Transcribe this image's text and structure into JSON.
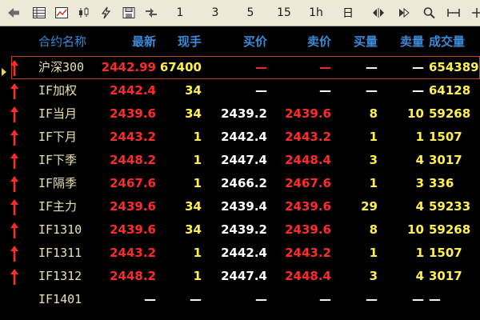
{
  "toolbar": {
    "periods": [
      "1",
      "3",
      "5",
      "15",
      "1h",
      "日"
    ]
  },
  "columns": {
    "name": "合约名称",
    "last": "最新",
    "volume_now": "现手",
    "bid": "买价",
    "ask": "卖价",
    "bid_qty": "买量",
    "ask_qty": "卖量",
    "turnover": "成交量"
  },
  "rows": [
    {
      "name": "沪深300",
      "last": "2442.99",
      "volume_now": "67400",
      "bid": "—",
      "ask": "—",
      "bid_qty": "—",
      "ask_qty": "—",
      "turnover": "654389"
    },
    {
      "name": "IF加权",
      "last": "2442.4",
      "volume_now": "34",
      "bid": "—",
      "ask": "—",
      "bid_qty": "—",
      "ask_qty": "—",
      "turnover": "64128"
    },
    {
      "name": "IF当月",
      "last": "2439.6",
      "volume_now": "34",
      "bid": "2439.2",
      "ask": "2439.6",
      "bid_qty": "8",
      "ask_qty": "10",
      "turnover": "59268"
    },
    {
      "name": "IF下月",
      "last": "2443.2",
      "volume_now": "1",
      "bid": "2442.4",
      "ask": "2443.2",
      "bid_qty": "1",
      "ask_qty": "1",
      "turnover": "1507"
    },
    {
      "name": "IF下季",
      "last": "2448.2",
      "volume_now": "1",
      "bid": "2447.4",
      "ask": "2448.4",
      "bid_qty": "3",
      "ask_qty": "4",
      "turnover": "3017"
    },
    {
      "name": "IF隔季",
      "last": "2467.6",
      "volume_now": "1",
      "bid": "2466.2",
      "ask": "2467.6",
      "bid_qty": "1",
      "ask_qty": "3",
      "turnover": "336"
    },
    {
      "name": "IF主力",
      "last": "2439.6",
      "volume_now": "34",
      "bid": "2439.4",
      "ask": "2439.6",
      "bid_qty": "29",
      "ask_qty": "4",
      "turnover": "59233"
    },
    {
      "name": "IF1310",
      "last": "2439.6",
      "volume_now": "34",
      "bid": "2439.2",
      "ask": "2439.6",
      "bid_qty": "8",
      "ask_qty": "10",
      "turnover": "59268"
    },
    {
      "name": "IF1311",
      "last": "2443.2",
      "volume_now": "1",
      "bid": "2442.4",
      "ask": "2443.2",
      "bid_qty": "1",
      "ask_qty": "1",
      "turnover": "1507"
    },
    {
      "name": "IF1312",
      "last": "2448.2",
      "volume_now": "1",
      "bid": "2447.4",
      "ask": "2448.4",
      "bid_qty": "3",
      "ask_qty": "4",
      "turnover": "3017"
    },
    {
      "name": "IF1401",
      "last": "—",
      "volume_now": "—",
      "bid": "—",
      "ask": "—",
      "bid_qty": "—",
      "ask_qty": "—",
      "turnover": "—"
    }
  ],
  "colors": {
    "up": "#ff2b2b",
    "neutral": "#fff14d",
    "header": "#3a8ad6",
    "name": "#e8e1b0",
    "selection": "#c8402a"
  }
}
